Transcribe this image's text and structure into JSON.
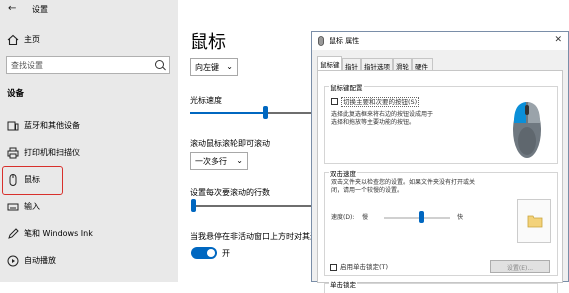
{
  "left_nav": {
    "back_symbol": "←",
    "window_title": "设置",
    "home_label": "主页",
    "search_placeholder": "查找设置",
    "section_title": "设备",
    "items": [
      {
        "label": "蓝牙和其他设备",
        "icon": "bluetooth-devices-icon"
      },
      {
        "label": "打印机和扫描仪",
        "icon": "printer-icon"
      },
      {
        "label": "鼠标",
        "icon": "mouse-icon"
      },
      {
        "label": "输入",
        "icon": "keyboard-icon"
      },
      {
        "label": "笔和 Windows Ink",
        "icon": "pen-icon"
      },
      {
        "label": "自动播放",
        "icon": "autoplay-icon"
      }
    ],
    "selected_item": "鼠标",
    "highlight_color": "#d8302c"
  },
  "main": {
    "title": "鼠标",
    "primary_button_select": "向左键",
    "cursor_speed_label": "光标速度",
    "cursor_speed_value": 0.42,
    "scroll_label": "滚动鼠标滚轮即可滚动",
    "scroll_select": "一次多行",
    "lines_label": "设置每次要滚动的行数",
    "lines_value": 0.02,
    "inactive_scroll_label": "当我悬停在非活动窗口上方时对其进行滚动",
    "inactive_scroll_state": "开",
    "accent_color": "#0067c0"
  },
  "dialog": {
    "title": "鼠标 属性",
    "close_symbol": "✕",
    "tabs": [
      "鼠标键",
      "指针",
      "指针选项",
      "滑轮",
      "硬件"
    ],
    "active_tab": "鼠标键",
    "button_config": {
      "group_title": "鼠标键配置",
      "checkbox_label": "切换主要和次要的按钮(S)",
      "description": [
        "选择此复选框来将右边的按钮设成用于",
        "选择和拖放等主要功能的按钮。"
      ]
    },
    "double_click": {
      "group_title": "双击速度",
      "description": [
        "双击文件夹以检查您的设置。如果文件夹没有打开或关",
        "闭，请用一个较慢的设置。"
      ],
      "speed_label": "速度(D):",
      "slow_label": "慢",
      "fast_label": "快",
      "speed_value": 0.6
    },
    "click_lock": {
      "group_title": "单击锁定",
      "checkbox_label": "启用单击锁定(T)",
      "settings_button": "设置(E)..."
    }
  }
}
